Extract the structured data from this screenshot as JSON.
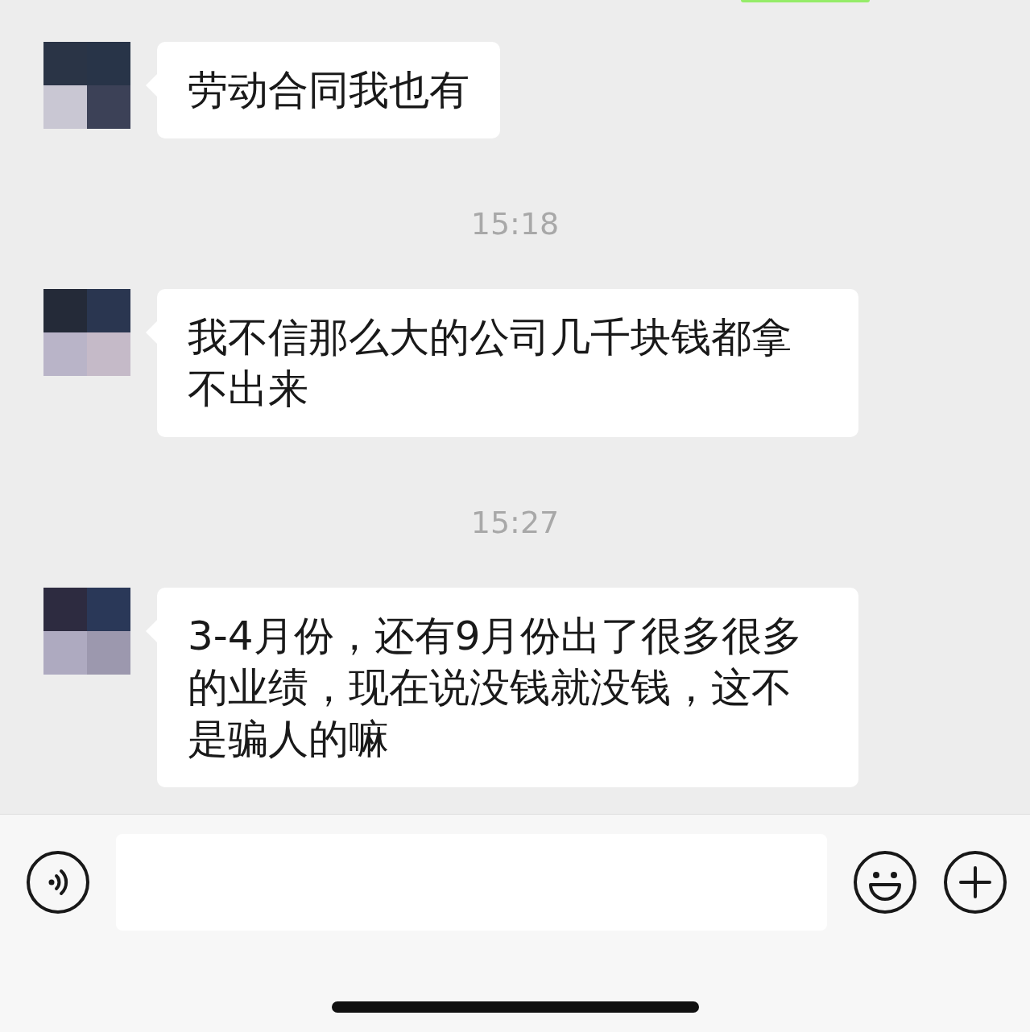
{
  "sent_partial": {
    "visible": true
  },
  "messages": [
    {
      "kind": "message",
      "text": "劳动合同我也有"
    },
    {
      "kind": "time",
      "text": "15:18"
    },
    {
      "kind": "message",
      "text": "我不信那么大的公司几千块钱都拿不出来"
    },
    {
      "kind": "time",
      "text": "15:27"
    },
    {
      "kind": "message",
      "text": "3-4月份，还有9月份出了很多很多的业绩，现在说没钱就没钱，这不是骗人的嘛"
    }
  ]
}
